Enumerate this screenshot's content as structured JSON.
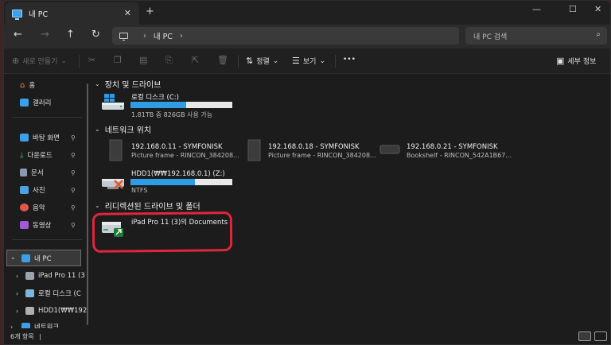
{
  "titlebar": {
    "tab_label": "내 PC",
    "tab_close": "✕",
    "new_tab": "+",
    "minimize": "—",
    "maximize": "☐",
    "close": "✕"
  },
  "nav": {
    "back": "←",
    "forward": "→",
    "up": "↑",
    "refresh": "↻"
  },
  "address": {
    "sep": "›",
    "crumb": "내 PC",
    "trailing_sep": "›"
  },
  "search": {
    "placeholder": "내 PC 검색",
    "icon": "⌕"
  },
  "commandbar": {
    "new_label": "새로 만들기",
    "new_icon": "⊕",
    "new_chev": "⌄",
    "sort_label": "정렬",
    "sort_icon": "⇅",
    "sort_chev": "⌄",
    "view_label": "보기",
    "view_icon": "☰",
    "view_chev": "⌄",
    "more": "•••",
    "details_label": "세부 정보",
    "details_icon": "▣",
    "cut_icon": "✂",
    "copy_icon": "❐",
    "paste_icon": "▤",
    "rename_icon": "⎘",
    "share_icon": "⇱",
    "delete_icon": "🗑"
  },
  "sidebar": {
    "home": "홈",
    "gallery": "갤러리",
    "quick": [
      {
        "label": "바탕 화면",
        "color": "#3ba0e8"
      },
      {
        "label": "다운로드",
        "color": "#2fb26b"
      },
      {
        "label": "문서",
        "color": "#8a9bb0"
      },
      {
        "label": "사진",
        "color": "#4aa3e0"
      },
      {
        "label": "음악",
        "color": "#e2574c"
      },
      {
        "label": "동영상",
        "color": "#a05cd6"
      }
    ],
    "pin": "📌",
    "tree_pc": "내 PC",
    "tree_children": [
      "iPad Pro 11 (3",
      "로컬 디스크 (C",
      "HDD1(₩₩192"
    ],
    "tree_network": "네트워크",
    "chev_open": "⌄",
    "chev_closed": "›"
  },
  "main": {
    "group_drives": "장치 및 드라이브",
    "group_network": "네트워크 위치",
    "group_redirected": "리디렉션된 드라이브 및 폴더",
    "group_chev": "⌄",
    "local_disk": {
      "name": "로컬 디스크 (C:)",
      "usage": "1.81TB 중 826GB 사용 가능",
      "fill_fraction": 0.55
    },
    "net_items": [
      {
        "name": "192.168.0.11 - SYMFONISK",
        "sub": "Picture frame - RINCON_384208..."
      },
      {
        "name": "192.168.0.18 - SYMFONISK",
        "sub": "Picture frame - RINCON_384208..."
      },
      {
        "name": "192.168.0.21 - SYMFONISK",
        "sub": "Bookshelf - RINCON_542A1B67..."
      }
    ],
    "hdd": {
      "name": "HDD1(₩₩192.168.0.1) (Z:)",
      "fs": "NTFS",
      "fill_fraction": 0.63
    },
    "ipad": {
      "name": "iPad Pro 11 (3)의 Documents"
    }
  },
  "status": {
    "count": "6개 항목",
    "cursor": "|"
  },
  "colors": {
    "accent": "#2f9ce6",
    "highlight": "#e0263b"
  }
}
